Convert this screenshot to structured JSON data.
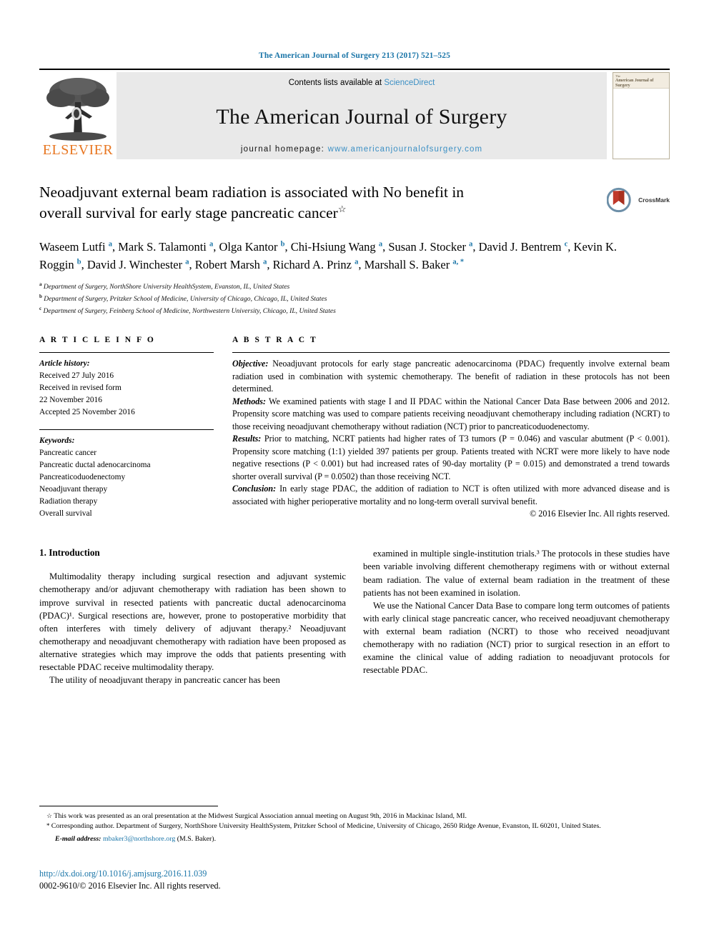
{
  "running_head": "The American Journal of Surgery 213 (2017) 521–525",
  "masthead": {
    "publisher_name": "ELSEVIER",
    "contents_prefix": "Contents lists available at ",
    "contents_link": "ScienceDirect",
    "journal_name": "The American Journal of Surgery",
    "homepage_prefix": "journal homepage: ",
    "homepage_url": "www.americanjournalofsurgery.com",
    "cover_title_small": "The",
    "cover_title": "American Journal of Surgery"
  },
  "title": {
    "line1": "Neoadjuvant external beam radiation is associated with No benefit in",
    "line2": "overall survival for early stage pancreatic cancer",
    "footnote_marker": "☆",
    "crossmark_label": "CrossMark"
  },
  "authors": [
    {
      "name": "Waseem Lutfi",
      "marks": "a"
    },
    {
      "name": "Mark S. Talamonti",
      "marks": "a"
    },
    {
      "name": "Olga Kantor",
      "marks": "b"
    },
    {
      "name": "Chi-Hsiung Wang",
      "marks": "a"
    },
    {
      "name": "Susan J. Stocker",
      "marks": "a"
    },
    {
      "name": "David J. Bentrem",
      "marks": "c"
    },
    {
      "name": "Kevin K. Roggin",
      "marks": "b"
    },
    {
      "name": "David J. Winchester",
      "marks": "a"
    },
    {
      "name": "Robert Marsh",
      "marks": "a"
    },
    {
      "name": "Richard A. Prinz",
      "marks": "a"
    },
    {
      "name": "Marshall S. Baker",
      "marks": "a, *"
    }
  ],
  "affiliations": [
    {
      "mark": "a",
      "text": "Department of Surgery, NorthShore University HealthSystem, Evanston, IL, United States"
    },
    {
      "mark": "b",
      "text": "Department of Surgery, Pritzker School of Medicine, University of Chicago, Chicago, IL, United States"
    },
    {
      "mark": "c",
      "text": "Department of Surgery, Feinberg School of Medicine, Northwestern University, Chicago, IL, United States"
    }
  ],
  "article_info": {
    "heading": "A R T I C L E  I N F O",
    "history_label": "Article history:",
    "history": [
      "Received 27 July 2016",
      "Received in revised form",
      "22 November 2016",
      "Accepted 25 November 2016"
    ],
    "keywords_label": "Keywords:",
    "keywords": [
      "Pancreatic cancer",
      "Pancreatic ductal adenocarcinoma",
      "Pancreaticoduodenectomy",
      "Neoadjuvant therapy",
      "Radiation therapy",
      "Overall survival"
    ]
  },
  "abstract": {
    "heading": "A B S T R A C T",
    "sections": [
      {
        "label": "Objective:",
        "text": " Neoadjuvant protocols for early stage pancreatic adenocarcinoma (PDAC) frequently involve external beam radiation used in combination with systemic chemotherapy. The benefit of radiation in these protocols has not been determined."
      },
      {
        "label": "Methods:",
        "text": " We examined patients with stage I and II PDAC within the National Cancer Data Base between 2006 and 2012. Propensity score matching was used to compare patients receiving neoadjuvant chemotherapy including radiation (NCRT) to those receiving neoadjuvant chemotherapy without radiation (NCT) prior to pancreaticoduodenectomy."
      },
      {
        "label": "Results:",
        "text": " Prior to matching, NCRT patients had higher rates of T3 tumors (P = 0.046) and vascular abutment (P < 0.001). Propensity score matching (1:1) yielded 397 patients per group. Patients treated with NCRT were more likely to have node negative resections (P < 0.001) but had increased rates of 90-day mortality (P = 0.015) and demonstrated a trend towards shorter overall survival (P = 0.0502) than those receiving NCT."
      },
      {
        "label": "Conclusion:",
        "text": " In early stage PDAC, the addition of radiation to NCT is often utilized with more advanced disease and is associated with higher perioperative mortality and no long-term overall survival benefit."
      }
    ],
    "copyright": "© 2016 Elsevier Inc. All rights reserved."
  },
  "body": {
    "section_heading": "1. Introduction",
    "left_paragraphs": [
      "Multimodality therapy including surgical resection and adjuvant systemic chemotherapy and/or adjuvant chemotherapy with radiation has been shown to improve survival in resected patients with pancreatic ductal adenocarcinoma (PDAC)¹. Surgical resections are, however, prone to postoperative morbidity that often interferes with timely delivery of adjuvant therapy.² Neoadjuvant chemotherapy and neoadjuvant chemotherapy with radiation have been proposed as alternative strategies which may improve the odds that patients presenting with resectable PDAC receive multimodality therapy.",
      "The utility of neoadjuvant therapy in pancreatic cancer has been"
    ],
    "right_paragraphs": [
      "examined in multiple single-institution trials.³ The protocols in these studies have been variable involving different chemotherapy regimens with or without external beam radiation. The value of external beam radiation in the treatment of these patients has not been examined in isolation.",
      "We use the National Cancer Data Base to compare long term outcomes of patients with early clinical stage pancreatic cancer, who received neoadjuvant chemotherapy with external beam radiation (NCRT) to those who received neoadjuvant chemotherapy with no radiation (NCT) prior to surgical resection in an effort to examine the clinical value of adding radiation to neoadjuvant protocols for resectable PDAC."
    ]
  },
  "footnotes": {
    "star_note": "This work was presented as an oral presentation at the Midwest Surgical Association annual meeting on August 9th, 2016 in Mackinac Island, MI.",
    "corresponding": "Corresponding author. Department of Surgery, NorthShore University HealthSystem, Pritzker School of Medicine, University of Chicago, 2650 Ridge Avenue, Evanston, IL 60201, United States.",
    "email_label": "E-mail address:",
    "email": "mbaker3@northshore.org",
    "email_owner": "(M.S. Baker)."
  },
  "footer": {
    "doi": "http://dx.doi.org/10.1016/j.amjsurg.2016.11.039",
    "issn_copyright": "0002-9610/© 2016 Elsevier Inc. All rights reserved."
  },
  "colors": {
    "link_blue": "#1a75a8",
    "elsevier_orange": "#E87722",
    "masthead_gray": "#e9e9e9"
  }
}
